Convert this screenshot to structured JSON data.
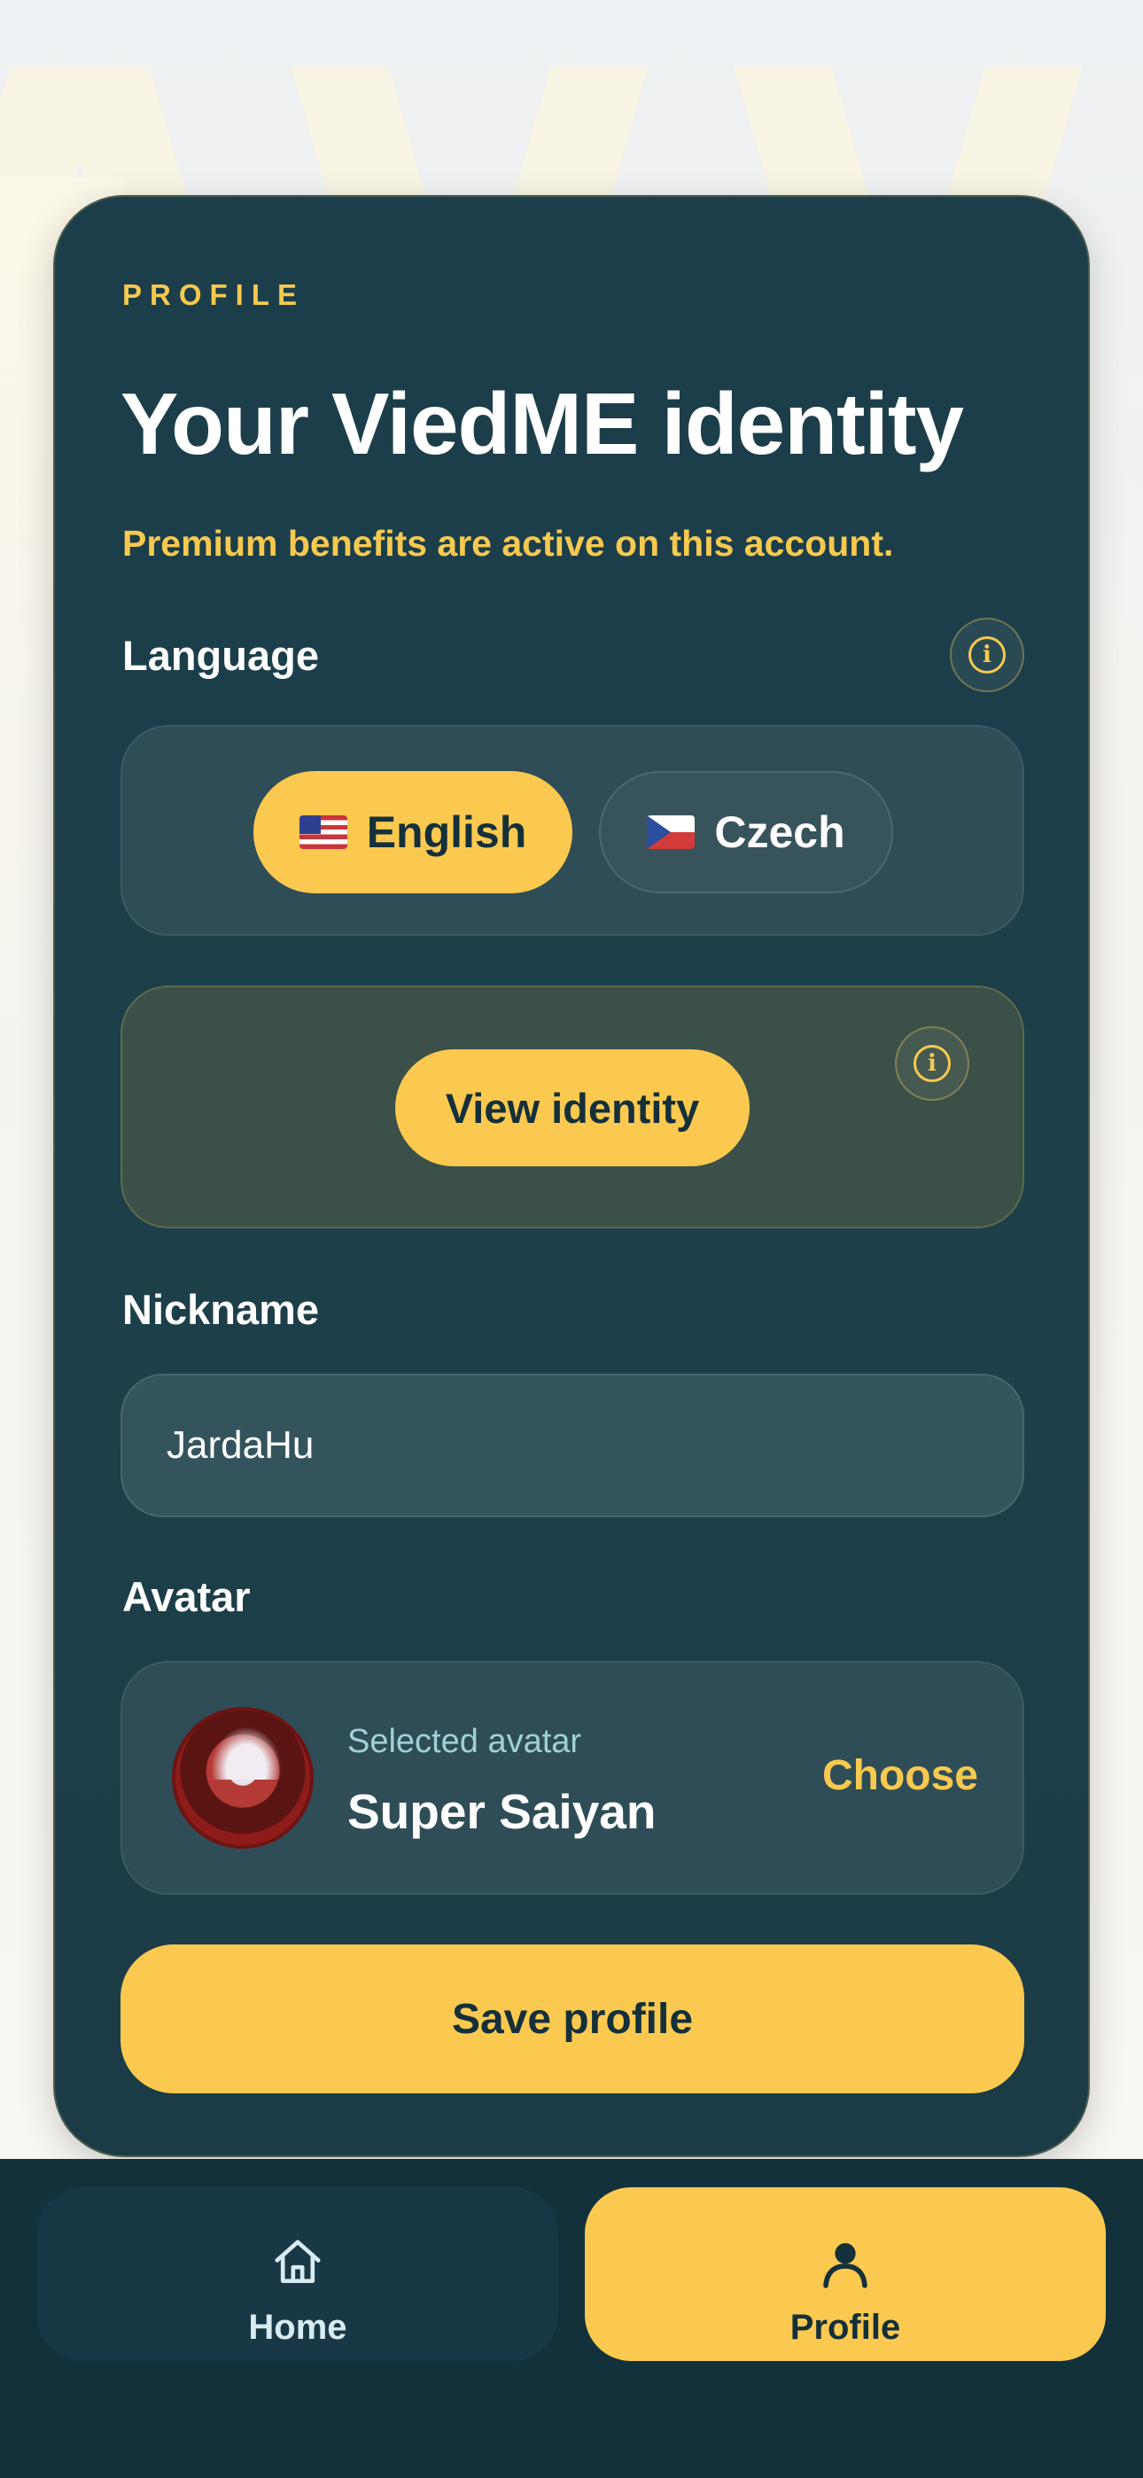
{
  "card": {
    "eyebrow": "PROFILE",
    "title": "Your ViedME identity",
    "premium_notice": "Premium benefits are active on this account."
  },
  "language": {
    "label": "Language",
    "options": [
      {
        "label": "English",
        "flag": "us-flag-icon",
        "selected": true
      },
      {
        "label": "Czech",
        "flag": "cz-flag-icon",
        "selected": false
      }
    ]
  },
  "identity": {
    "button_label": "View identity"
  },
  "nickname": {
    "label": "Nickname",
    "value": "JardaHu"
  },
  "avatar": {
    "label": "Avatar",
    "caption": "Selected avatar",
    "name": "Super Saiyan",
    "choose_label": "Choose"
  },
  "save_label": "Save profile",
  "nav": {
    "items": [
      {
        "label": "Home",
        "icon": "home-icon",
        "active": false
      },
      {
        "label": "Profile",
        "icon": "person-icon",
        "active": true
      }
    ]
  },
  "colors": {
    "accent": "#fbc94f",
    "card_bg": "#1b3e4a",
    "nav_bg": "#13313b"
  }
}
